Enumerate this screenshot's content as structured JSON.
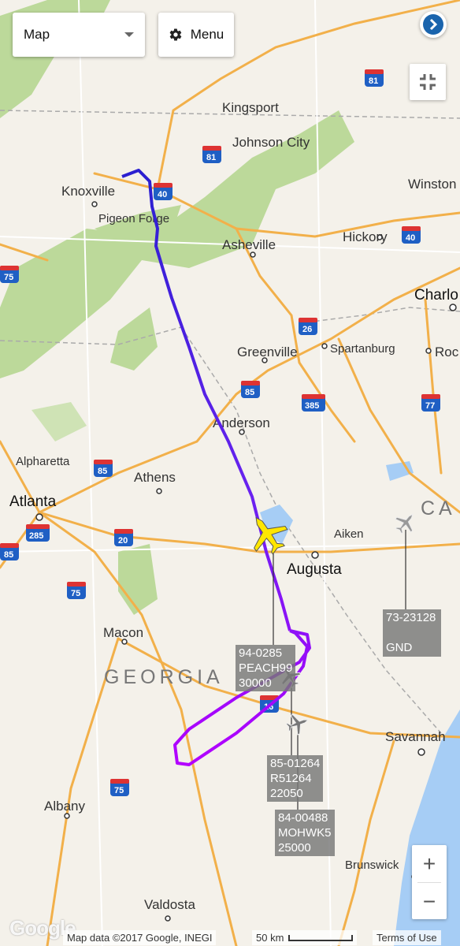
{
  "map_type_select": {
    "value": "Map"
  },
  "menu_button": {
    "label": "Menu"
  },
  "places": [
    {
      "name": "Kingsport"
    },
    {
      "name": "Johnson City"
    },
    {
      "name": "Knoxville"
    },
    {
      "name": "Pigeon Forge"
    },
    {
      "name": "Winston"
    },
    {
      "name": "Asheville"
    },
    {
      "name": "Hickory"
    },
    {
      "name": "Charlo"
    },
    {
      "name": "Greenville"
    },
    {
      "name": "Spartanburg"
    },
    {
      "name": "Roc"
    },
    {
      "name": "Anderson"
    },
    {
      "name": "Alpharetta"
    },
    {
      "name": "Athens"
    },
    {
      "name": "Atlanta"
    },
    {
      "name": "Aiken"
    },
    {
      "name": "Augusta"
    },
    {
      "name": "Macon"
    },
    {
      "name": "GEORGIA"
    },
    {
      "name": "Savannah"
    },
    {
      "name": "Albany"
    },
    {
      "name": "Brunswick"
    },
    {
      "name": "Valdosta"
    },
    {
      "name": "CA"
    }
  ],
  "highways": [
    "81",
    "81",
    "40",
    "40",
    "75",
    "26",
    "85",
    "385",
    "77",
    "85",
    "285",
    "20",
    "75",
    "16",
    "75",
    "85"
  ],
  "aircraft_labels": [
    {
      "lines": [
        "94-0285",
        "PEACH99",
        "30000"
      ]
    },
    {
      "lines": [
        "85-01264",
        "R51264",
        "22050"
      ]
    },
    {
      "lines": [
        "84-00488",
        "MOHWK5",
        "25000"
      ]
    },
    {
      "lines": [
        "73-23128",
        "",
        "GND"
      ]
    }
  ],
  "zoom": {
    "in": "+",
    "out": "−"
  },
  "attribution": {
    "logo": "Google",
    "map_data": "Map data ©2017 Google, INEGI",
    "scale": "50 km",
    "terms": "Terms of Use"
  },
  "colors": {
    "track_start": "#2a1fd0",
    "track_end": "#b300ff",
    "selected_aircraft": "#ffe600",
    "highway": "#f2a33a",
    "park": "#b5d68c",
    "water": "#9ecaf4"
  }
}
